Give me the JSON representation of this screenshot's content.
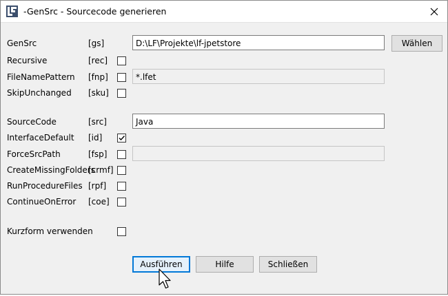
{
  "window": {
    "title": "-GenSrc - Sourcecode generieren",
    "app_icon": "lf-app-icon",
    "close_icon": "close-icon"
  },
  "params": {
    "gensrc": {
      "label": "GenSrc",
      "abbr": "[gs]",
      "value": "D:\\LF\\Projekte\\lf-jpetstore"
    },
    "recursive": {
      "label": "Recursive",
      "abbr": "[rec]",
      "checked": false
    },
    "filenamepattern": {
      "label": "FileNamePattern",
      "abbr": "[fnp]",
      "checked": false,
      "value": "*.lfet"
    },
    "skipunchanged": {
      "label": "SkipUnchanged",
      "abbr": "[sku]",
      "checked": false
    },
    "sourcecode": {
      "label": "SourceCode",
      "abbr": "[src]",
      "value": "Java"
    },
    "interfacedefault": {
      "label": "InterfaceDefault",
      "abbr": "[id]",
      "checked": true
    },
    "forcesrcpath": {
      "label": "ForceSrcPath",
      "abbr": "[fsp]",
      "checked": false,
      "value": ""
    },
    "createmissingfolders": {
      "label": "CreateMissingFolders",
      "abbr": "[crmf]",
      "checked": false
    },
    "runprocedurefiles": {
      "label": "RunProcedureFiles",
      "abbr": "[rpf]",
      "checked": false
    },
    "continueonerror": {
      "label": "ContinueOnError",
      "abbr": "[coe]",
      "checked": false
    },
    "kurzform": {
      "label": "Kurzform verwenden",
      "checked": false
    }
  },
  "buttons": {
    "choose": "Wählen",
    "run": "Ausführen",
    "help": "Hilfe",
    "close": "Schließen"
  }
}
